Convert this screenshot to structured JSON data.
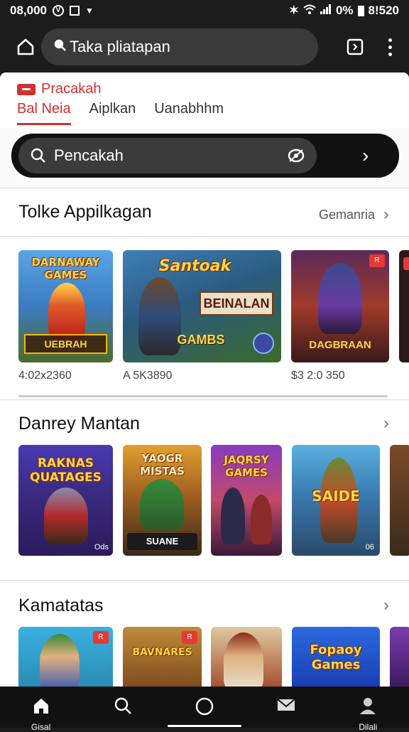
{
  "status_bar": {
    "time_left": "08,000",
    "time_right": "8!520",
    "battery": "0%"
  },
  "url_bar": {
    "address": "Taka pliatapan"
  },
  "brand": {
    "name": "Pracakah",
    "color": "#d32f2f"
  },
  "tabs": [
    {
      "label": "Bal Neia",
      "active": true
    },
    {
      "label": "Aiplkan",
      "active": false
    },
    {
      "label": "Uanabhhm",
      "active": false
    }
  ],
  "search": {
    "placeholder": "Pencakah"
  },
  "sections": [
    {
      "title": "Tolke Appilkagan",
      "more_label": "Gemanria"
    },
    {
      "title": "Danrey Mantan",
      "more_label": ""
    },
    {
      "title": "Kamatatas",
      "more_label": ""
    }
  ],
  "row1": [
    {
      "title": "DARNAWAY GAMES",
      "sub": "UEBRAH",
      "price": "4:02x2360"
    },
    {
      "title": "Santoak",
      "banner": "BEINALAN",
      "sub": "GAMBS",
      "price": "A 5K3890"
    },
    {
      "title": "",
      "sub": "DAGBRAAN",
      "price": "$3 2:0 350"
    }
  ],
  "row2": [
    {
      "title": "RAKNAS QUATAGES",
      "corner": "Ods"
    },
    {
      "title": "YAOGR MISTAS",
      "sub": "SUANE"
    },
    {
      "title": "JAQRSY GAMES"
    },
    {
      "title": "SAIDE",
      "corner": "06"
    }
  ],
  "row3": [
    {
      "title": ""
    },
    {
      "title": "BAVNARES"
    },
    {
      "title": ""
    },
    {
      "title": "Fopaoy Games"
    }
  ],
  "bottom_nav": [
    {
      "label": "Gisal",
      "icon": "home-icon"
    },
    {
      "label": "",
      "icon": "search-icon"
    },
    {
      "label": "",
      "icon": "circle-icon"
    },
    {
      "label": "",
      "icon": "mail-icon"
    },
    {
      "label": "Dilali",
      "icon": "person-icon"
    }
  ]
}
